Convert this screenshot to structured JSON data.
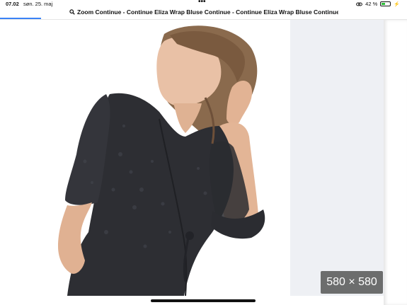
{
  "status_bar": {
    "time": "07.02",
    "date": "søn. 25. maj",
    "battery": "42 %",
    "battery_level": 0.42,
    "icons": [
      "more-dots-icon",
      "link-icon",
      "battery-icon",
      "charging-icon"
    ]
  },
  "address_bar": {
    "title": "Zoom Continue - Continue Eliza Wrap Bluse Continue - Continue Eliza Wrap Bluse Continue",
    "icon": "search-icon"
  },
  "viewer": {
    "dimension_label": "580 × 580"
  },
  "colors": {
    "accent": "#3a82f6",
    "badge_bg": "#5a5a5a",
    "side_panel": "#eef0f4"
  }
}
